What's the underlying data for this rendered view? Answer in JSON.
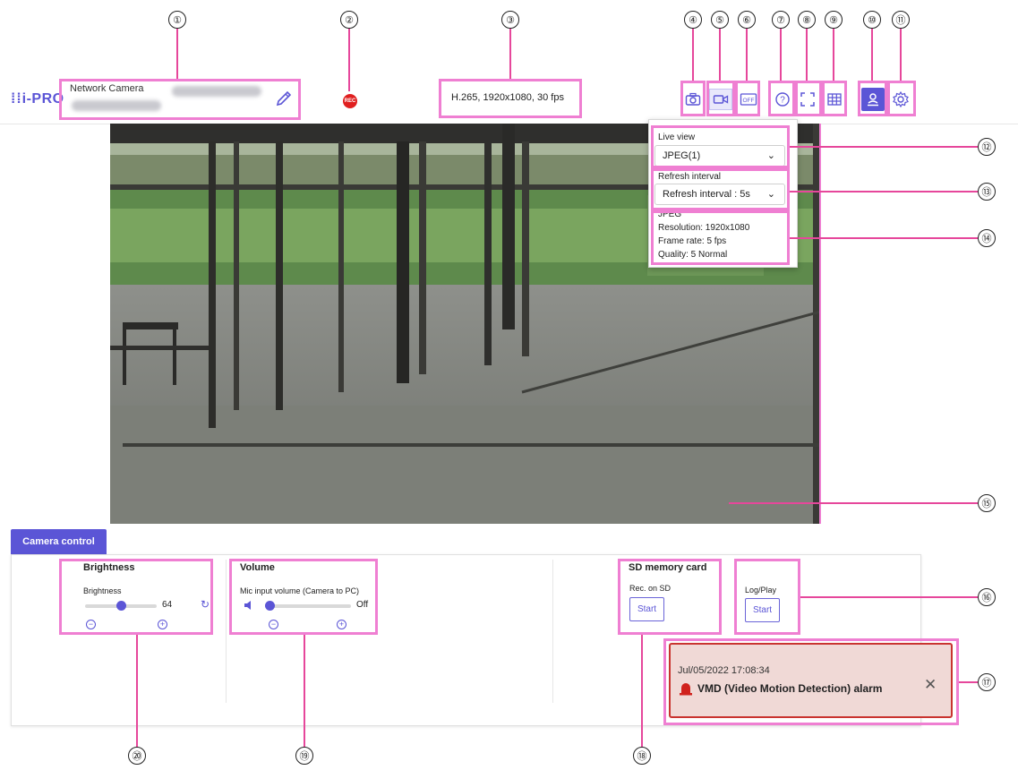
{
  "header": {
    "logo": "i-PRO",
    "camera_label": "Network Camera",
    "stream_info": "H.265, 1920x1080, 30 fps"
  },
  "callouts": [
    "①",
    "②",
    "③",
    "④",
    "⑤",
    "⑥",
    "⑦",
    "⑧",
    "⑨",
    "⑩",
    "⑪",
    "⑫",
    "⑬",
    "⑭",
    "⑮",
    "⑯",
    "⑰",
    "⑱",
    "⑲",
    "⑳"
  ],
  "dropdown": {
    "live_view_label": "Live view",
    "live_view_value": "JPEG(1)",
    "refresh_label": "Refresh interval",
    "refresh_value": "Refresh interval : 5s",
    "info_title": "JPEG",
    "resolution": "Resolution: 1920x1080",
    "frame_rate": "Frame rate: 5 fps",
    "quality": "Quality: 5 Normal"
  },
  "camera_control": {
    "tab_label": "Camera control",
    "brightness": {
      "title": "Brightness",
      "slider_label": "Brightness",
      "value": "64",
      "level": 0.5
    },
    "volume": {
      "title": "Volume",
      "slider_label": "Mic input volume (Camera to PC)",
      "value": "Off",
      "level": 0
    },
    "sd": {
      "title": "SD memory card",
      "sub_label": "Rec. on SD",
      "button": "Start"
    },
    "log": {
      "sub_label": "Log/Play",
      "button": "Start"
    }
  },
  "alarm": {
    "timestamp": "Jul/05/2022 17:08:34",
    "message": "VMD (Video Motion Detection) alarm"
  },
  "colors": {
    "accent": "#5b55d6",
    "callout_box": "#ef7fd2",
    "callout_line": "#e6479b",
    "rec": "#e01f1f",
    "alarm_bg": "#f0d9d6",
    "alarm_border": "#c9332f"
  }
}
